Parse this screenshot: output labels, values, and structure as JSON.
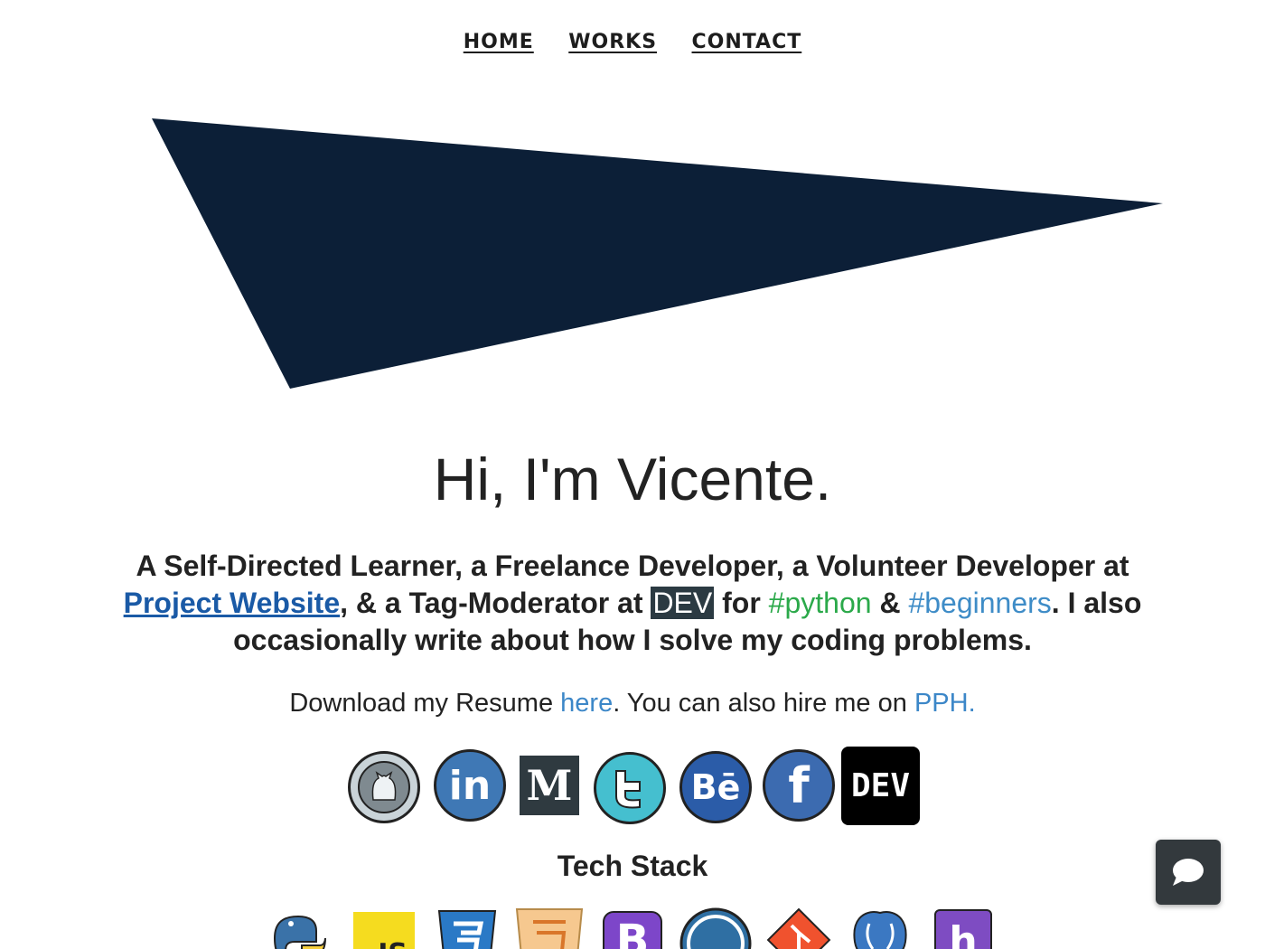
{
  "nav": {
    "home": "HOME",
    "works": "WORKS",
    "contact": "CONTACT"
  },
  "hero": {
    "shape_color": "#0c1f37"
  },
  "intro": {
    "greeting": "Hi, I'm Vicente.",
    "bio_part1": "A Self-Directed Learner, a Freelance Developer, a Volunteer Developer at ",
    "project_link": "Project Website",
    "bio_part2": ", & a Tag-Moderator at ",
    "dev_badge": "DEV",
    "bio_part3": " for ",
    "tag_python": "#python",
    "bio_part4": " & ",
    "tag_beginners": "#beginners",
    "bio_part5": ". I also occasionally write about how I solve my coding problems.",
    "resume_text": "Download my Resume ",
    "resume_link": "here",
    "hire_text": ". You can also hire me on ",
    "hire_link": "PPH."
  },
  "socials": [
    {
      "name": "github-icon",
      "color": "#c9d3d8"
    },
    {
      "name": "linkedin-icon",
      "label": "in",
      "color": "#3f78b5"
    },
    {
      "name": "medium-icon",
      "label": "M",
      "color": "#2f3a40"
    },
    {
      "name": "twitter-icon",
      "color": "#45bfcf"
    },
    {
      "name": "behance-icon",
      "label": "Bē",
      "color": "#2b5ca8"
    },
    {
      "name": "facebook-icon",
      "label": "f",
      "color": "#3c6bb0"
    },
    {
      "name": "dev-icon",
      "label": "DEV",
      "color": "#000000"
    }
  ],
  "tech_stack": {
    "heading": "Tech Stack",
    "items": [
      {
        "name": "python-icon",
        "colors": [
          "#3a72a8",
          "#f7cf3d"
        ]
      },
      {
        "name": "javascript-icon",
        "label": "JS",
        "color": "#f5dc1f"
      },
      {
        "name": "css3-icon",
        "color": "#2a79c6"
      },
      {
        "name": "html5-icon",
        "color": "#f6c88f"
      },
      {
        "name": "bootstrap-icon",
        "label": "B",
        "color": "#7d46c9"
      },
      {
        "name": "wordpress-icon",
        "color": "#2f6fa3"
      },
      {
        "name": "git-icon",
        "color": "#f0522e"
      },
      {
        "name": "postgresql-icon",
        "color": "#3b78c2"
      },
      {
        "name": "heroku-icon",
        "label": "h",
        "color": "#7e4cc2"
      }
    ]
  },
  "chat": {
    "name": "chat-bubble-icon",
    "color": "#33393d"
  }
}
